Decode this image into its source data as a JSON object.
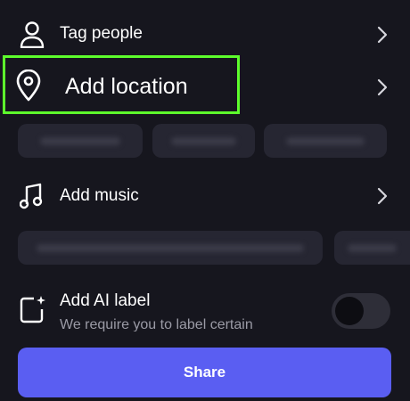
{
  "rows": {
    "tag_people": {
      "label": "Tag people",
      "icon": "person-icon"
    },
    "add_location": {
      "label": "Add location",
      "icon": "location-pin-icon"
    },
    "add_music": {
      "label": "Add music",
      "icon": "music-note-icon"
    },
    "add_ai_label": {
      "label": "Add AI label",
      "description": "We require you to label certain",
      "icon": "ai-label-icon",
      "toggle_on": false
    }
  },
  "share_button": {
    "label": "Share"
  },
  "colors": {
    "background": "#16161e",
    "highlight": "#5dfc2c",
    "share_button": "#5a5ef2",
    "chip": "#262632"
  }
}
